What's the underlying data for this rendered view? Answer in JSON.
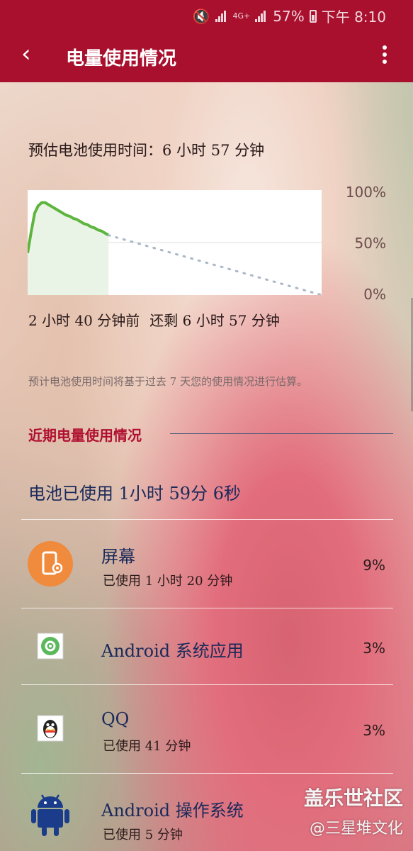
{
  "status_bar": {
    "network_label": "4G+",
    "battery_percent": "57%",
    "time": "下午 8:10"
  },
  "app_bar": {
    "back_icon": "back-arrow-icon",
    "title": "电量使用情况",
    "more_icon": "more-vertical-icon"
  },
  "estimate": {
    "label": "预估电池使用时间：6 小时 57 分钟"
  },
  "chart_data": {
    "type": "line",
    "title": "",
    "xlabel": "",
    "ylabel": "",
    "ylim": [
      0,
      100
    ],
    "ytick_labels": [
      "100%",
      "50%",
      "0%"
    ],
    "x_labels": [
      "2 小时 40 分钟前",
      "还剩 6 小时 57 分钟"
    ],
    "series": [
      {
        "style": "actual",
        "color": "#5db53e",
        "x": [
          0,
          5,
          10,
          15,
          20,
          25,
          30,
          35,
          40,
          45,
          50,
          55,
          60,
          65,
          70,
          75,
          80,
          85,
          90,
          95,
          100,
          105,
          110,
          115
        ],
        "y": [
          40,
          60,
          78,
          85,
          88,
          88,
          86,
          84,
          82,
          80,
          78,
          76,
          75,
          73,
          72,
          70,
          68,
          67,
          65,
          64,
          62,
          61,
          59,
          57
        ]
      },
      {
        "style": "projection",
        "color": "#a9b7c8",
        "x": [
          115,
          418
        ],
        "y": [
          57,
          0
        ]
      }
    ]
  },
  "note": "预计电池使用时间将基于过去 7 天您的使用情况进行估算。",
  "section": {
    "title": "近期电量使用情况"
  },
  "battery_used": "电池已使用 1小时 59分 6秒",
  "apps": [
    {
      "icon": "screen-icon",
      "name": "屏幕",
      "sub": "已使用 1 小时 20 分钟",
      "pct": "9%"
    },
    {
      "icon": "android-settings-icon",
      "name": "Android 系统应用",
      "sub": "",
      "pct": "3%"
    },
    {
      "icon": "qq-penguin-icon",
      "name": "QQ",
      "sub": "已使用 41 分钟",
      "pct": "3%"
    },
    {
      "icon": "android-robot-icon",
      "name": "Android 操作系统",
      "sub": "已使用 5 分钟",
      "pct": ""
    }
  ],
  "watermark": {
    "line1": "盖乐世社区",
    "line2": "@三星堆文化"
  }
}
